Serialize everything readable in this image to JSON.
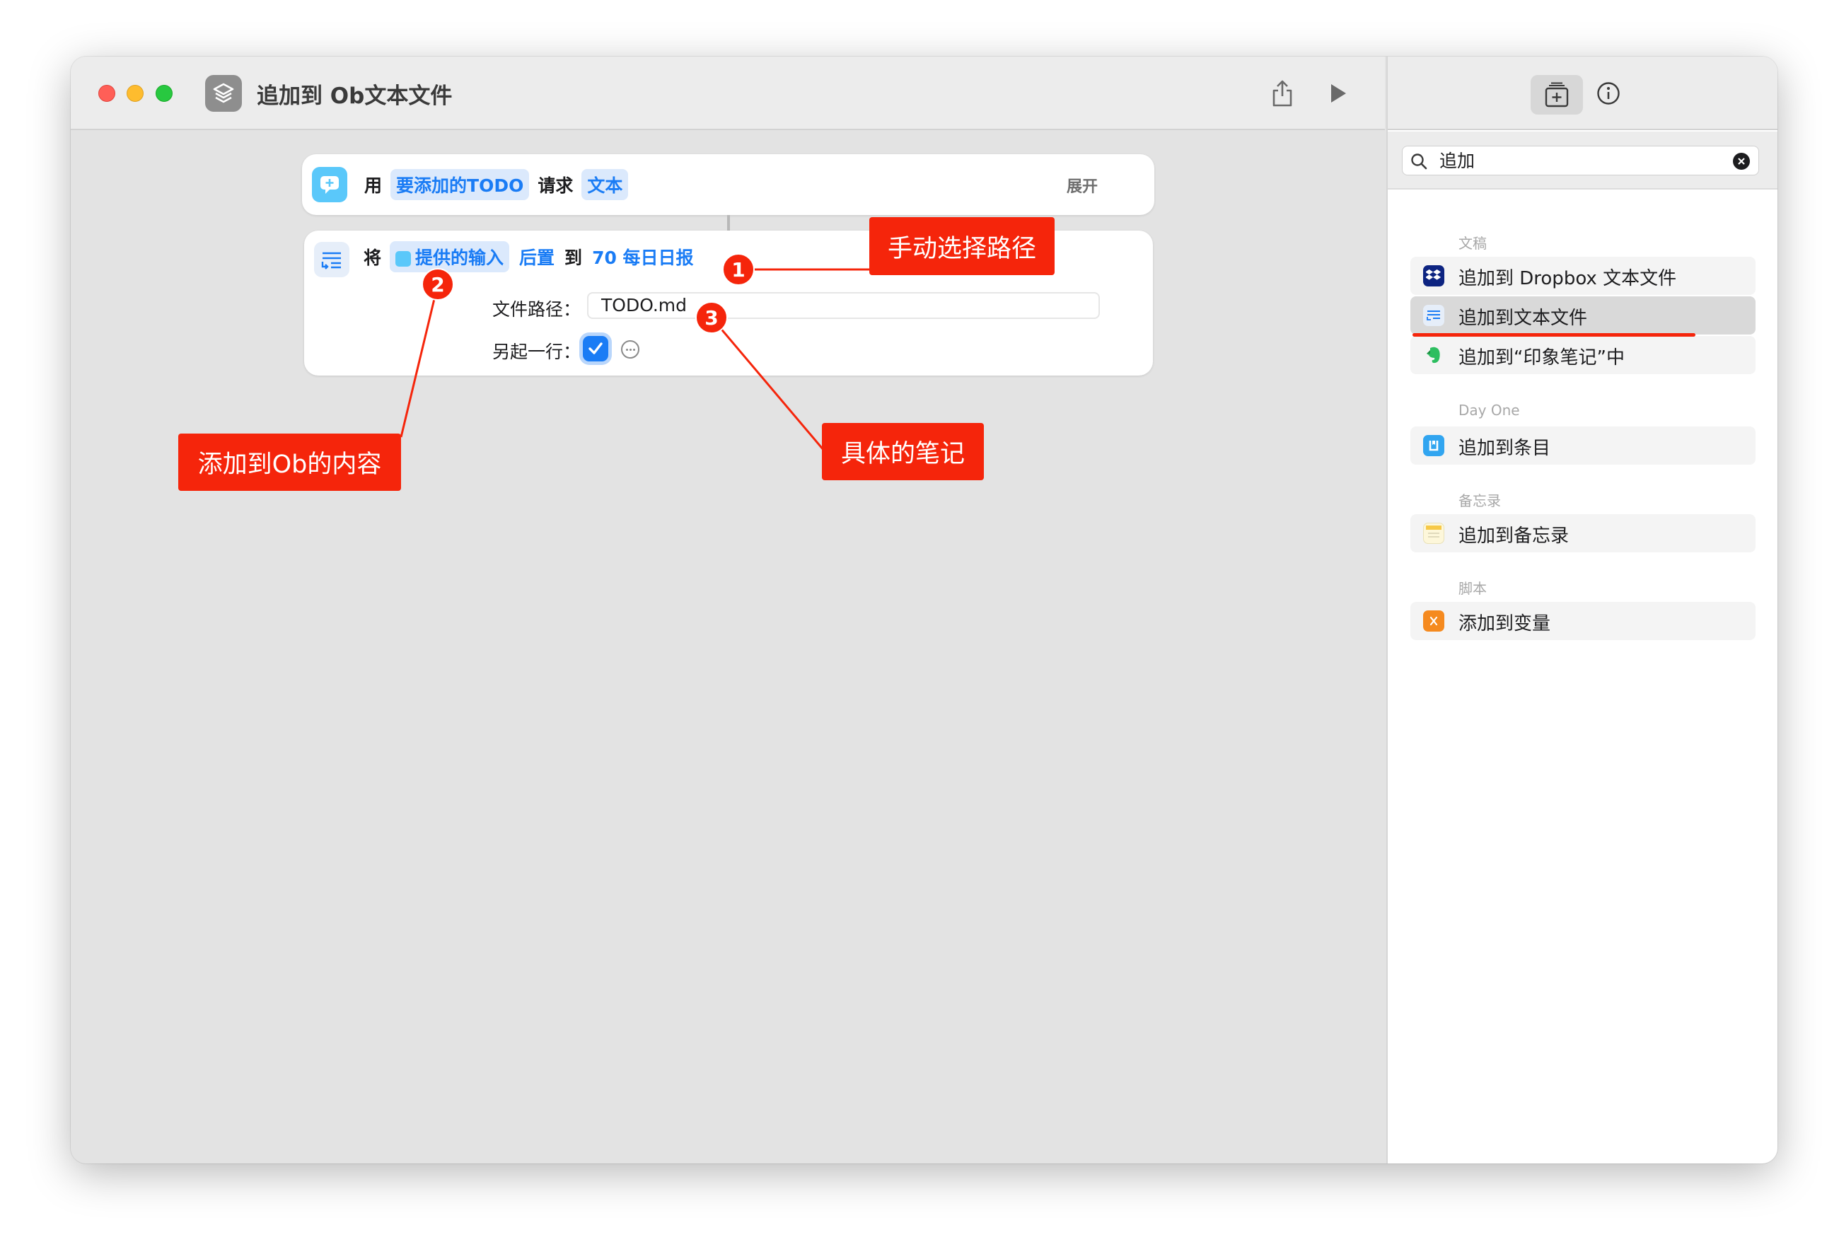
{
  "window": {
    "title": "追加到 Ob文本文件",
    "controls": [
      "close",
      "minimize",
      "maximize"
    ],
    "toolbar": {
      "share_icon": "share-icon",
      "run_icon": "play-icon"
    }
  },
  "editor": {
    "action1": {
      "icon": "ask-for-input-icon",
      "prefix": "用",
      "prompt_token": "要添加的TODO",
      "middle": "请求",
      "type_token": "文本",
      "expand_label": "展开"
    },
    "action2": {
      "icon": "append-text-icon",
      "prefix": "将",
      "input_token": "提供的输入",
      "position_token": "后置",
      "to_word": "到",
      "file_token": "70 每日日报",
      "path_label": "文件路径：",
      "path_value": "TODO.md",
      "newline_label": "另起一行：",
      "newline_checked": true
    }
  },
  "annotations": {
    "callout_1": "手动选择路径",
    "callout_2": "添加到Ob的内容",
    "callout_3": "具体的笔记",
    "badge_1": "1",
    "badge_2": "2",
    "badge_3": "3",
    "color": "#f5250b"
  },
  "panel": {
    "search": {
      "value": "追加"
    },
    "groups": [
      {
        "category": "文稿",
        "items": [
          {
            "label": "追加到 Dropbox 文本文件",
            "icon": "dropbox-icon"
          },
          {
            "label": "追加到文本文件",
            "icon": "append-text-icon",
            "selected": true
          },
          {
            "label": "追加到“印象笔记”中",
            "icon": "evernote-icon"
          }
        ]
      },
      {
        "category": "Day One",
        "items": [
          {
            "label": "追加到条目",
            "icon": "day-one-icon"
          }
        ]
      },
      {
        "category": "备忘录",
        "items": [
          {
            "label": "追加到备忘录",
            "icon": "notes-icon"
          }
        ]
      },
      {
        "category": "脚本",
        "items": [
          {
            "label": "添加到变量",
            "icon": "variable-icon"
          }
        ]
      }
    ]
  },
  "colors": {
    "accent": "#1a7cf5",
    "token_bg": "#dbe9fc",
    "annotation": "#f5250b"
  }
}
